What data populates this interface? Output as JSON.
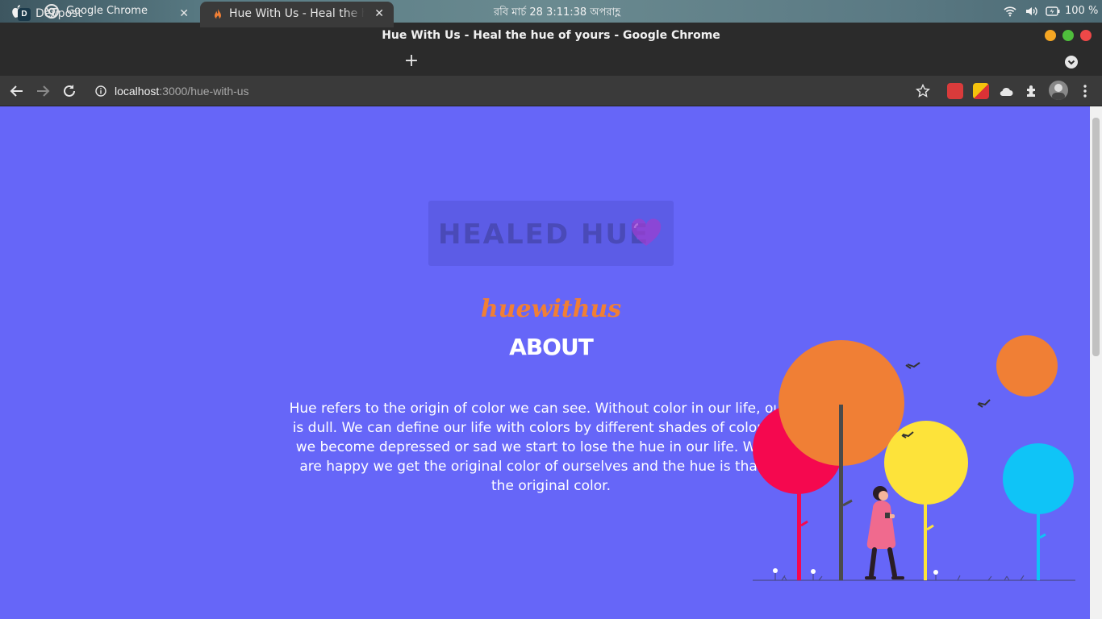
{
  "os_bar": {
    "app_name": "Google Chrome",
    "clock": "রবি মার্চ 28   3:11:38 অপরাহ্ণ",
    "battery_percent": "100 %"
  },
  "window": {
    "title": "Hue With Us - Heal the hue of yours - Google Chrome"
  },
  "tabs": [
    {
      "label": "Devpost",
      "favicon": "D",
      "active": false
    },
    {
      "label": "Hue With Us - Heal the hue of yours",
      "active": true
    }
  ],
  "toolbar": {
    "url_host": "localhost",
    "url_path": ":3000/hue-with-us"
  },
  "page": {
    "logo_text": "HEALED HUE",
    "brand": "huewithus",
    "heading": "ABOUT",
    "description": "Hue refers to the origin of color we can see. Without color in our life, our life is dull. We can define our life with colors by different shades of color. When we become depressed or sad we start to lose the hue in our life. When we are happy we get the original color of ourselves and the hue is that thing the original color."
  },
  "colors": {
    "page_bg": "#6666f8",
    "brand": "#f07f35",
    "tree_orange": "#f07f35",
    "tree_pink": "#f5084f",
    "tree_yellow": "#fde33a",
    "tree_blue": "#0fc4f7"
  }
}
